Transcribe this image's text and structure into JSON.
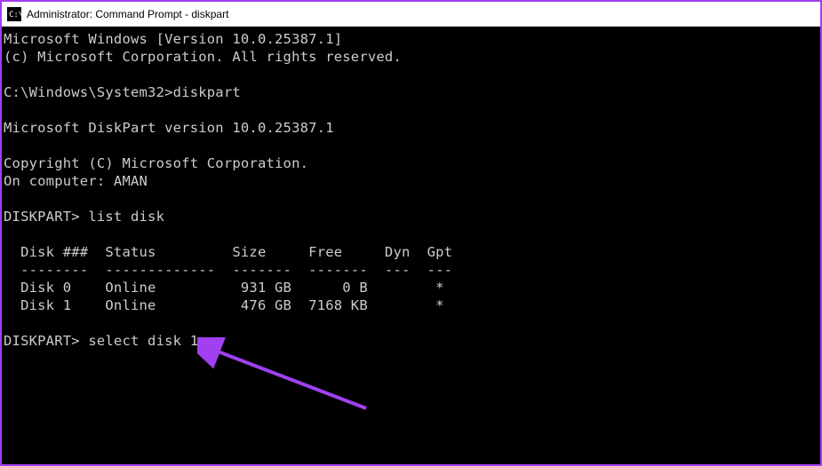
{
  "titlebar": {
    "title": "Administrator: Command Prompt - diskpart"
  },
  "terminal": {
    "lines": [
      "Microsoft Windows [Version 10.0.25387.1]",
      "(c) Microsoft Corporation. All rights reserved.",
      "",
      "C:\\Windows\\System32>diskpart",
      "",
      "Microsoft DiskPart version 10.0.25387.1",
      "",
      "Copyright (C) Microsoft Corporation.",
      "On computer: AMAN",
      "",
      "DISKPART> list disk",
      "",
      "  Disk ###  Status         Size     Free     Dyn  Gpt",
      "  --------  -------------  -------  -------  ---  ---",
      "  Disk 0    Online          931 GB      0 B        *",
      "  Disk 1    Online          476 GB  7168 KB        *",
      "",
      "DISKPART> select disk 1"
    ]
  },
  "disks": {
    "headers": [
      "Disk ###",
      "Status",
      "Size",
      "Free",
      "Dyn",
      "Gpt"
    ],
    "rows": [
      {
        "id": "Disk 0",
        "status": "Online",
        "size": "931 GB",
        "free": "0 B",
        "dyn": "",
        "gpt": "*"
      },
      {
        "id": "Disk 1",
        "status": "Online",
        "size": "476 GB",
        "free": "7168 KB",
        "dyn": "",
        "gpt": "*"
      }
    ]
  },
  "annotation": {
    "arrow_color": "#a040f0"
  }
}
